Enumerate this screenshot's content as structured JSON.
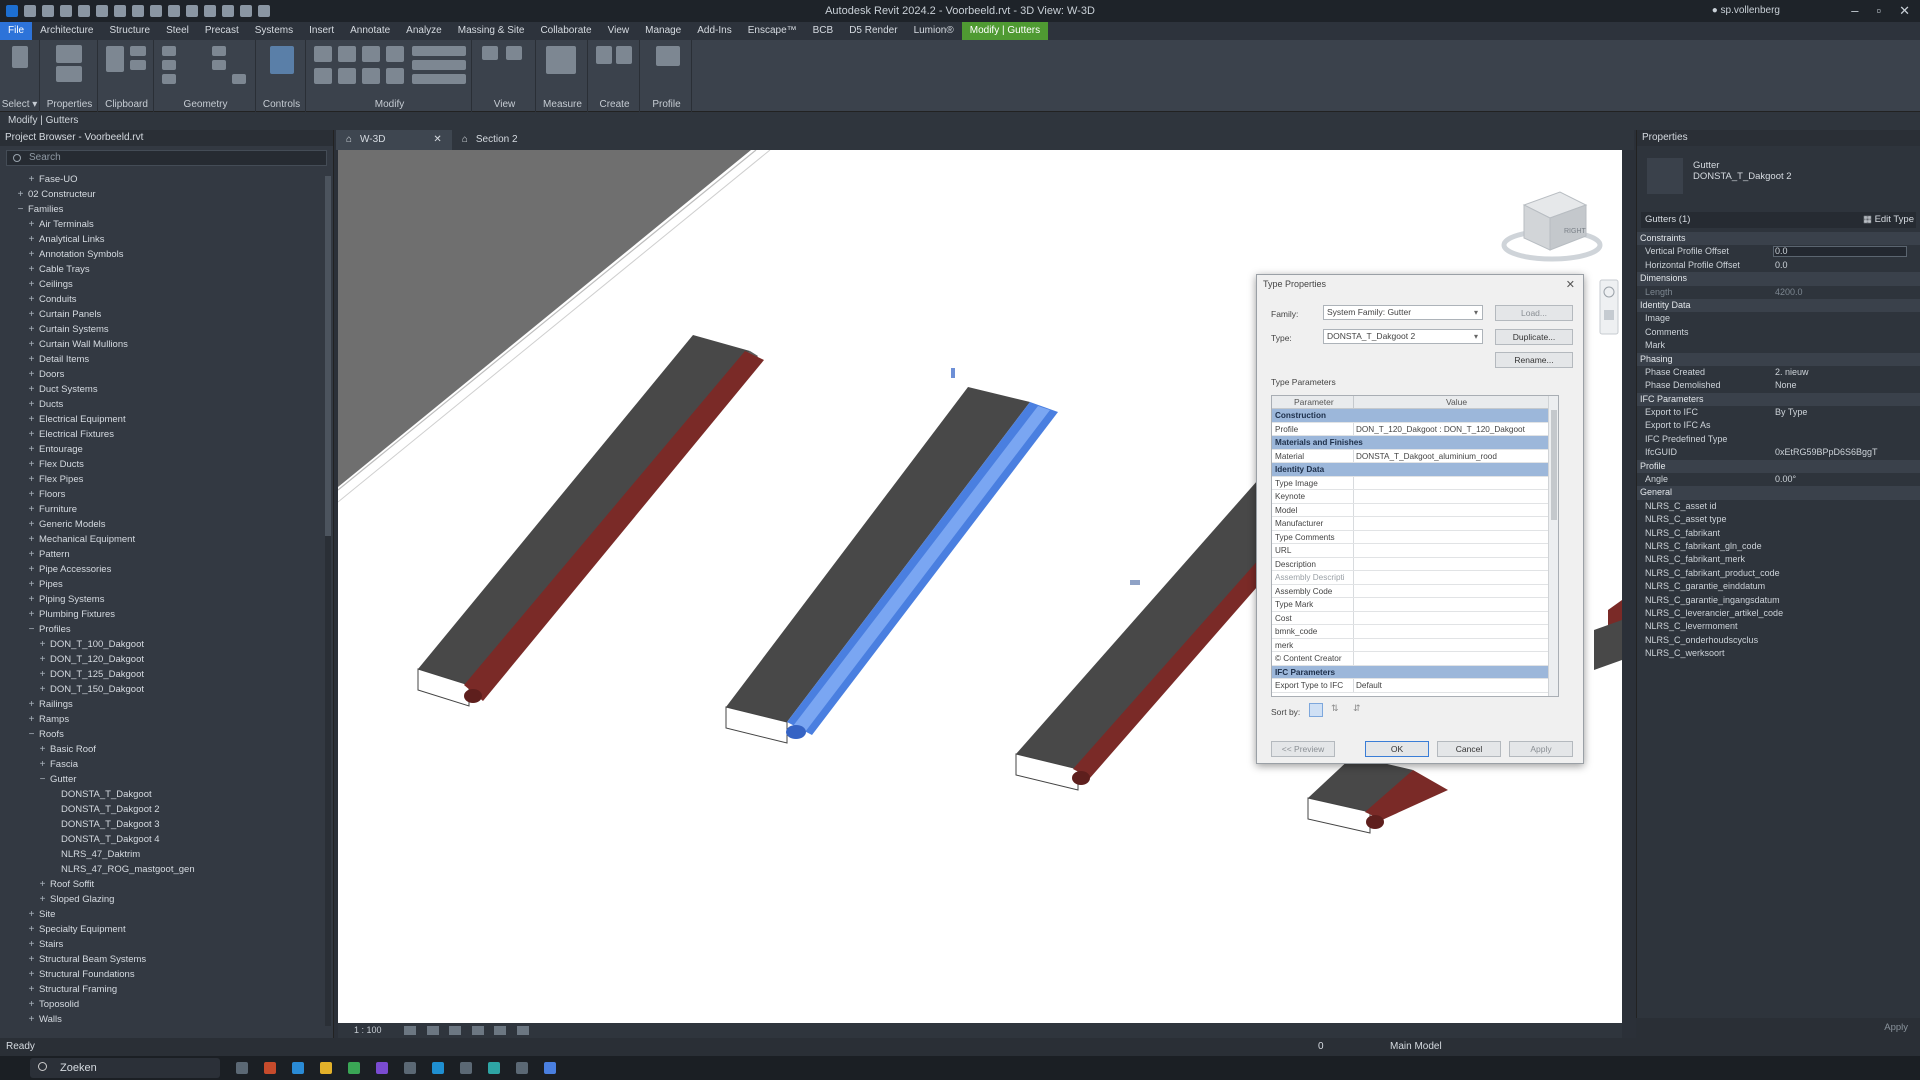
{
  "window": {
    "title": "Autodesk Revit 2024.2 - Voorbeeld.rvt - 3D View: W-3D",
    "user": "sp.vollenberg"
  },
  "ribbon_tabs": [
    "File",
    "Architecture",
    "Structure",
    "Steel",
    "Precast",
    "Systems",
    "Insert",
    "Annotate",
    "Analyze",
    "Massing & Site",
    "Collaborate",
    "View",
    "Manage",
    "Add-Ins",
    "Enscape™",
    "BCB",
    "D5 Render",
    "Lumion®",
    "Modify | Gutters"
  ],
  "ribbon_panels": [
    "Select ▾",
    "Properties",
    "Clipboard",
    "Geometry",
    "Controls",
    "Modify",
    "View",
    "Measure",
    "Create",
    "Profile"
  ],
  "ribbon_buttons": {
    "modify": "Modify",
    "paste": "Paste",
    "activate": "Activate",
    "add_remove": "Add/Remove Segments"
  },
  "context_bar": "Modify | Gutters",
  "project_browser": {
    "title": "Project Browser - Voorbeeld.rvt",
    "search_placeholder": "Search",
    "items": [
      {
        "label": "Fase-UO",
        "lvl": 1,
        "exp": "+"
      },
      {
        "label": "02 Constructeur",
        "lvl": 0,
        "exp": "+"
      },
      {
        "label": "Families",
        "lvl": 0,
        "exp": "−",
        "icon": true
      },
      {
        "label": "Air Terminals",
        "lvl": 1,
        "exp": "+"
      },
      {
        "label": "Analytical Links",
        "lvl": 1,
        "exp": "+"
      },
      {
        "label": "Annotation Symbols",
        "lvl": 1,
        "exp": "+"
      },
      {
        "label": "Cable Trays",
        "lvl": 1,
        "exp": "+"
      },
      {
        "label": "Ceilings",
        "lvl": 1,
        "exp": "+"
      },
      {
        "label": "Conduits",
        "lvl": 1,
        "exp": "+"
      },
      {
        "label": "Curtain Panels",
        "lvl": 1,
        "exp": "+"
      },
      {
        "label": "Curtain Systems",
        "lvl": 1,
        "exp": "+"
      },
      {
        "label": "Curtain Wall Mullions",
        "lvl": 1,
        "exp": "+"
      },
      {
        "label": "Detail Items",
        "lvl": 1,
        "exp": "+"
      },
      {
        "label": "Doors",
        "lvl": 1,
        "exp": "+"
      },
      {
        "label": "Duct Systems",
        "lvl": 1,
        "exp": "+"
      },
      {
        "label": "Ducts",
        "lvl": 1,
        "exp": "+"
      },
      {
        "label": "Electrical Equipment",
        "lvl": 1,
        "exp": "+"
      },
      {
        "label": "Electrical Fixtures",
        "lvl": 1,
        "exp": "+"
      },
      {
        "label": "Entourage",
        "lvl": 1,
        "exp": "+"
      },
      {
        "label": "Flex Ducts",
        "lvl": 1,
        "exp": "+"
      },
      {
        "label": "Flex Pipes",
        "lvl": 1,
        "exp": "+"
      },
      {
        "label": "Floors",
        "lvl": 1,
        "exp": "+"
      },
      {
        "label": "Furniture",
        "lvl": 1,
        "exp": "+"
      },
      {
        "label": "Generic Models",
        "lvl": 1,
        "exp": "+"
      },
      {
        "label": "Mechanical Equipment",
        "lvl": 1,
        "exp": "+"
      },
      {
        "label": "Pattern",
        "lvl": 1,
        "exp": "+"
      },
      {
        "label": "Pipe Accessories",
        "lvl": 1,
        "exp": "+"
      },
      {
        "label": "Pipes",
        "lvl": 1,
        "exp": "+"
      },
      {
        "label": "Piping Systems",
        "lvl": 1,
        "exp": "+"
      },
      {
        "label": "Plumbing Fixtures",
        "lvl": 1,
        "exp": "+"
      },
      {
        "label": "Profiles",
        "lvl": 1,
        "exp": "−"
      },
      {
        "label": "DON_T_100_Dakgoot",
        "lvl": 2,
        "exp": "+"
      },
      {
        "label": "DON_T_120_Dakgoot",
        "lvl": 2,
        "exp": "+"
      },
      {
        "label": "DON_T_125_Dakgoot",
        "lvl": 2,
        "exp": "+"
      },
      {
        "label": "DON_T_150_Dakgoot",
        "lvl": 2,
        "exp": "+"
      },
      {
        "label": "Railings",
        "lvl": 1,
        "exp": "+"
      },
      {
        "label": "Ramps",
        "lvl": 1,
        "exp": "+"
      },
      {
        "label": "Roofs",
        "lvl": 1,
        "exp": "−"
      },
      {
        "label": "Basic Roof",
        "lvl": 2,
        "exp": "+"
      },
      {
        "label": "Fascia",
        "lvl": 2,
        "exp": "+"
      },
      {
        "label": "Gutter",
        "lvl": 2,
        "exp": "−"
      },
      {
        "label": "DONSTA_T_Dakgoot",
        "lvl": 3,
        "exp": ""
      },
      {
        "label": "DONSTA_T_Dakgoot 2",
        "lvl": 3,
        "exp": ""
      },
      {
        "label": "DONSTA_T_Dakgoot 3",
        "lvl": 3,
        "exp": ""
      },
      {
        "label": "DONSTA_T_Dakgoot 4",
        "lvl": 3,
        "exp": ""
      },
      {
        "label": "NLRS_47_Daktrim",
        "lvl": 3,
        "exp": ""
      },
      {
        "label": "NLRS_47_ROG_mastgoot_gen",
        "lvl": 3,
        "exp": ""
      },
      {
        "label": "Roof Soffit",
        "lvl": 2,
        "exp": "+"
      },
      {
        "label": "Sloped Glazing",
        "lvl": 2,
        "exp": "+"
      },
      {
        "label": "Site",
        "lvl": 1,
        "exp": "+"
      },
      {
        "label": "Specialty Equipment",
        "lvl": 1,
        "exp": "+"
      },
      {
        "label": "Stairs",
        "lvl": 1,
        "exp": "+"
      },
      {
        "label": "Structural Beam Systems",
        "lvl": 1,
        "exp": "+"
      },
      {
        "label": "Structural Foundations",
        "lvl": 1,
        "exp": "+"
      },
      {
        "label": "Structural Framing",
        "lvl": 1,
        "exp": "+"
      },
      {
        "label": "Toposolid",
        "lvl": 1,
        "exp": "+"
      },
      {
        "label": "Walls",
        "lvl": 1,
        "exp": "+"
      }
    ]
  },
  "view_tabs": [
    {
      "label": "W-3D",
      "active": true
    },
    {
      "label": "Section 2",
      "active": false
    }
  ],
  "view_bar": {
    "scale": "1 : 100"
  },
  "viewcube": {
    "face": "RIGHT"
  },
  "status_bar": {
    "left": "Ready",
    "model": "Main Model",
    "zero": "0"
  },
  "properties": {
    "title": "Properties",
    "type_family": "Gutter",
    "type_name": "DONSTA_T_Dakgoot 2",
    "selector": "Gutters (1)",
    "edit_type": "Edit Type",
    "apply": "Apply",
    "rows": [
      {
        "g": "Constraints"
      },
      {
        "n": "Vertical Profile Offset",
        "v": "0.0",
        "box": true
      },
      {
        "n": "Horizontal Profile Offset",
        "v": "0.0"
      },
      {
        "g": "Dimensions"
      },
      {
        "n": "Length",
        "v": "4200.0",
        "dim": true
      },
      {
        "g": "Identity Data"
      },
      {
        "n": "Image",
        "v": ""
      },
      {
        "n": "Comments",
        "v": ""
      },
      {
        "n": "Mark",
        "v": ""
      },
      {
        "g": "Phasing"
      },
      {
        "n": "Phase Created",
        "v": "2. nieuw"
      },
      {
        "n": "Phase Demolished",
        "v": "None"
      },
      {
        "g": "IFC Parameters"
      },
      {
        "n": "Export to IFC",
        "v": "By Type"
      },
      {
        "n": "Export to IFC As",
        "v": ""
      },
      {
        "n": "IFC Predefined Type",
        "v": ""
      },
      {
        "n": "IfcGUID",
        "v": "0xEtRG59BPpD6S6BggT"
      },
      {
        "g": "Profile"
      },
      {
        "n": "Angle",
        "v": "0.00°"
      },
      {
        "g": "General"
      },
      {
        "n": "NLRS_C_asset id",
        "v": ""
      },
      {
        "n": "NLRS_C_asset type",
        "v": ""
      },
      {
        "n": "NLRS_C_fabrikant",
        "v": ""
      },
      {
        "n": "NLRS_C_fabrikant_gln_code",
        "v": ""
      },
      {
        "n": "NLRS_C_fabrikant_merk",
        "v": ""
      },
      {
        "n": "NLRS_C_fabrikant_product_code",
        "v": ""
      },
      {
        "n": "NLRS_C_garantie_einddatum",
        "v": ""
      },
      {
        "n": "NLRS_C_garantie_ingangsdatum",
        "v": ""
      },
      {
        "n": "NLRS_C_leverancier_artikel_code",
        "v": ""
      },
      {
        "n": "NLRS_C_levermoment",
        "v": ""
      },
      {
        "n": "NLRS_C_onderhoudscyclus",
        "v": ""
      },
      {
        "n": "NLRS_C_werksoort",
        "v": ""
      }
    ]
  },
  "dialog": {
    "title": "Type Properties",
    "family_label": "Family:",
    "family_value": "System Family: Gutter",
    "type_label": "Type:",
    "type_value": "DONSTA_T_Dakgoot 2",
    "load": "Load...",
    "duplicate": "Duplicate...",
    "rename": "Rename...",
    "type_params": "Type Parameters",
    "col_param": "Parameter",
    "col_value": "Value",
    "rows": [
      {
        "g": "Construction"
      },
      {
        "n": "Profile",
        "v": "DON_T_120_Dakgoot : DON_T_120_Dakgoot"
      },
      {
        "g": "Materials and Finishes"
      },
      {
        "n": "Material",
        "v": "DONSTA_T_Dakgoot_aluminium_rood"
      },
      {
        "g": "Identity Data"
      },
      {
        "n": "Type Image",
        "v": ""
      },
      {
        "n": "Keynote",
        "v": ""
      },
      {
        "n": "Model",
        "v": ""
      },
      {
        "n": "Manufacturer",
        "v": ""
      },
      {
        "n": "Type Comments",
        "v": ""
      },
      {
        "n": "URL",
        "v": ""
      },
      {
        "n": "Description",
        "v": ""
      },
      {
        "n": "Assembly Descripti",
        "v": "",
        "dim": true
      },
      {
        "n": "Assembly Code",
        "v": ""
      },
      {
        "n": "Type Mark",
        "v": ""
      },
      {
        "n": "Cost",
        "v": ""
      },
      {
        "n": "bmnk_code",
        "v": ""
      },
      {
        "n": "merk",
        "v": ""
      },
      {
        "n": "© Content Creator",
        "v": ""
      },
      {
        "g": "IFC Parameters"
      },
      {
        "n": "Export Type to IFC",
        "v": "Default"
      }
    ],
    "sort_by": "Sort by:",
    "preview": "<< Preview",
    "ok": "OK",
    "cancel": "Cancel",
    "apply": "Apply"
  },
  "taskbar": {
    "search": "Zoeken"
  },
  "colors": {
    "accent_green": "#4f9a32",
    "file_blue": "#2d73d9",
    "gutter_red": "#7a2a27",
    "gutter_selected": "#4a7fe0",
    "roof_dark": "#484848"
  }
}
